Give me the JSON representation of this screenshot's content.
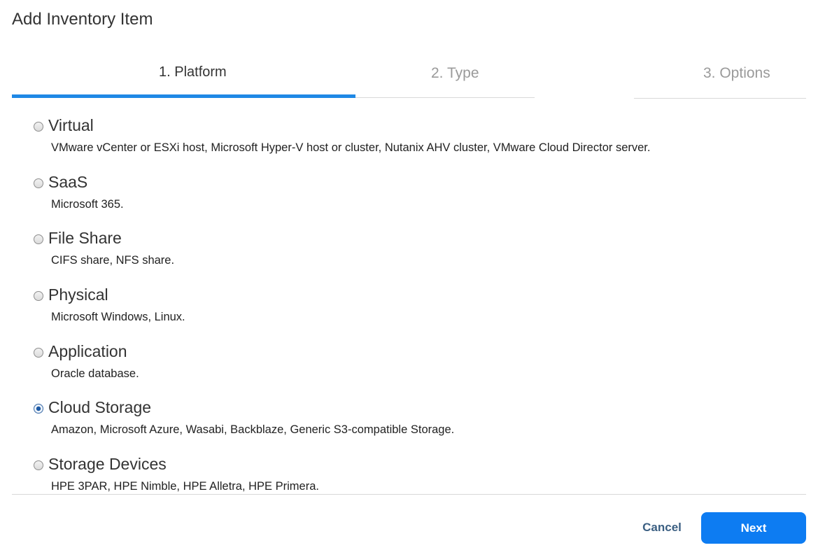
{
  "dialog": {
    "title": "Add Inventory Item"
  },
  "tabs": [
    {
      "label": "1. Platform",
      "state": "active"
    },
    {
      "label": "2. Type",
      "state": "inactive"
    },
    {
      "label": "3. Options",
      "state": "inactive"
    }
  ],
  "options": [
    {
      "title": "Virtual",
      "description": "VMware vCenter or ESXi host, Microsoft Hyper-V host or cluster, Nutanix AHV cluster, VMware Cloud Director server.",
      "checked": false
    },
    {
      "title": "SaaS",
      "description": "Microsoft 365.",
      "checked": false
    },
    {
      "title": "File Share",
      "description": "CIFS share, NFS share.",
      "checked": false
    },
    {
      "title": "Physical",
      "description": "Microsoft Windows, Linux.",
      "checked": false
    },
    {
      "title": "Application",
      "description": "Oracle database.",
      "checked": false
    },
    {
      "title": "Cloud Storage",
      "description": "Amazon, Microsoft Azure, Wasabi, Backblaze, Generic S3-compatible Storage.",
      "checked": true
    },
    {
      "title": "Storage Devices",
      "description": "HPE 3PAR, HPE Nimble, HPE Alletra, HPE Primera.",
      "checked": false
    }
  ],
  "footer": {
    "cancel_label": "Cancel",
    "next_label": "Next"
  },
  "colors": {
    "accent": "#1e88e5",
    "next_button": "#0d7cf2",
    "cancel_text": "#3b5f82"
  }
}
